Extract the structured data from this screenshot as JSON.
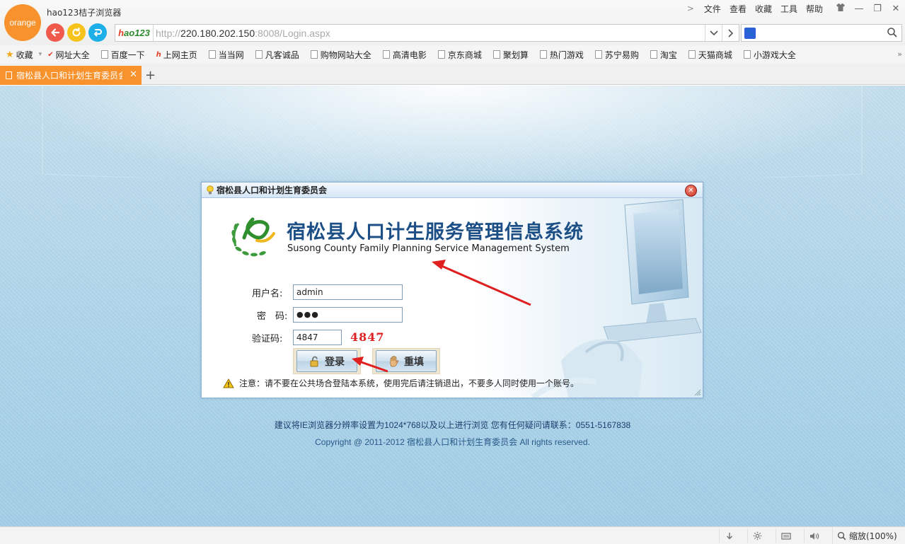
{
  "browser": {
    "logo_text": "orange",
    "title": "hao123桔子浏览器",
    "menu": [
      "文件",
      "查看",
      "收藏",
      "工具",
      "帮助"
    ],
    "hao123_label": "hao123",
    "url_prefix": "http://",
    "url_host": "220.180.202.150",
    "url_rest": ":8008/Login.aspx",
    "search_value": ""
  },
  "bookmarks": {
    "favorites_label": "收藏",
    "items": [
      "网址大全",
      "百度一下",
      "上网主页",
      "当当网",
      "凡客诚品",
      "购物网站大全",
      "高清电影",
      "京东商城",
      "聚划算",
      "热门游戏",
      "苏宁易购",
      "淘宝",
      "天猫商城",
      "小游戏大全"
    ]
  },
  "tabs": {
    "active_title": "宿松县人口和计划生育委员会",
    "new_tab_label": "+"
  },
  "login_window": {
    "title": "宿松县人口和计划生育委员会",
    "system_title_cn": "宿松县人口计生服务管理信息系统",
    "system_title_en": "Susong County Family Planning Service Management System",
    "username_label": "用户名:",
    "username_value": "admin",
    "password_label": "密　码:",
    "password_value": "●●●",
    "captcha_label": "验证码:",
    "captcha_value": "4847",
    "captcha_image_text": "4847",
    "login_button": "登录",
    "reset_button": "重填",
    "notice": "注意：请不要在公共场合登陆本系统，使用完后请注销退出，不要多人同时使用一个账号。"
  },
  "footer": {
    "line1": "建议将IE浏览器分辨率设置为1024*768以及以上进行浏览 您有任何疑问请联系：0551-5167838",
    "line2": "Copyright @ 2011-2012 宿松县人口和计划生育委员会 All rights reserved."
  },
  "statusbar": {
    "zoom": "缩放(100%)"
  },
  "colors": {
    "accent": "#f7922d",
    "arrow": "#e02020",
    "title_blue": "#1c4f86"
  }
}
